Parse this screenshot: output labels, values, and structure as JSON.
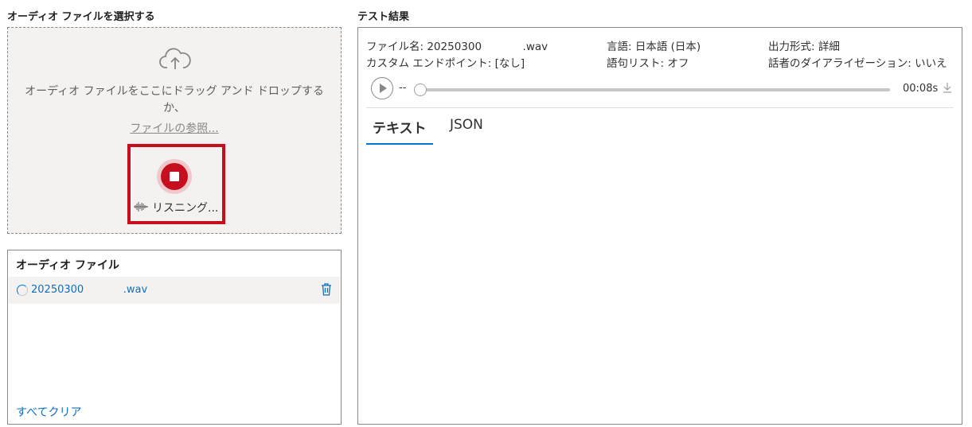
{
  "left": {
    "title": "オーディオ ファイルを選択する",
    "drop_text": "オーディオ ファイルをここにドラッグ アンド ドロップするか、",
    "browse_label": "ファイルの参照...",
    "listening_label": "リスニング..."
  },
  "audio_files": {
    "title": "オーディオ ファイル",
    "files": [
      {
        "name": "20250300            .wav"
      }
    ],
    "clear_all": "すべてクリア"
  },
  "results": {
    "title": "テスト結果",
    "file_name": "ファイル名: 20250300            .wav",
    "language": "言語: 日本語 (日本)",
    "output_format": "出力形式: 詳細",
    "custom_endpoint": "カスタム エンドポイント: [なし]",
    "phrase_list": "語句リスト: オフ",
    "diarization": "話者のダイアライゼーション: いいえ",
    "player": {
      "position_text": "--",
      "duration": "00:08s",
      "progress": 0
    },
    "tabs": [
      "テキスト",
      "JSON"
    ],
    "active_tab": "テキスト"
  },
  "colors": {
    "accent": "#0078d4",
    "record_red": "#c50f1f",
    "link": "#106ebe"
  },
  "icons": [
    "cloud-upload-icon",
    "stop-icon",
    "waveform-icon",
    "trash-icon",
    "play-icon",
    "download-icon",
    "spinner-icon"
  ]
}
